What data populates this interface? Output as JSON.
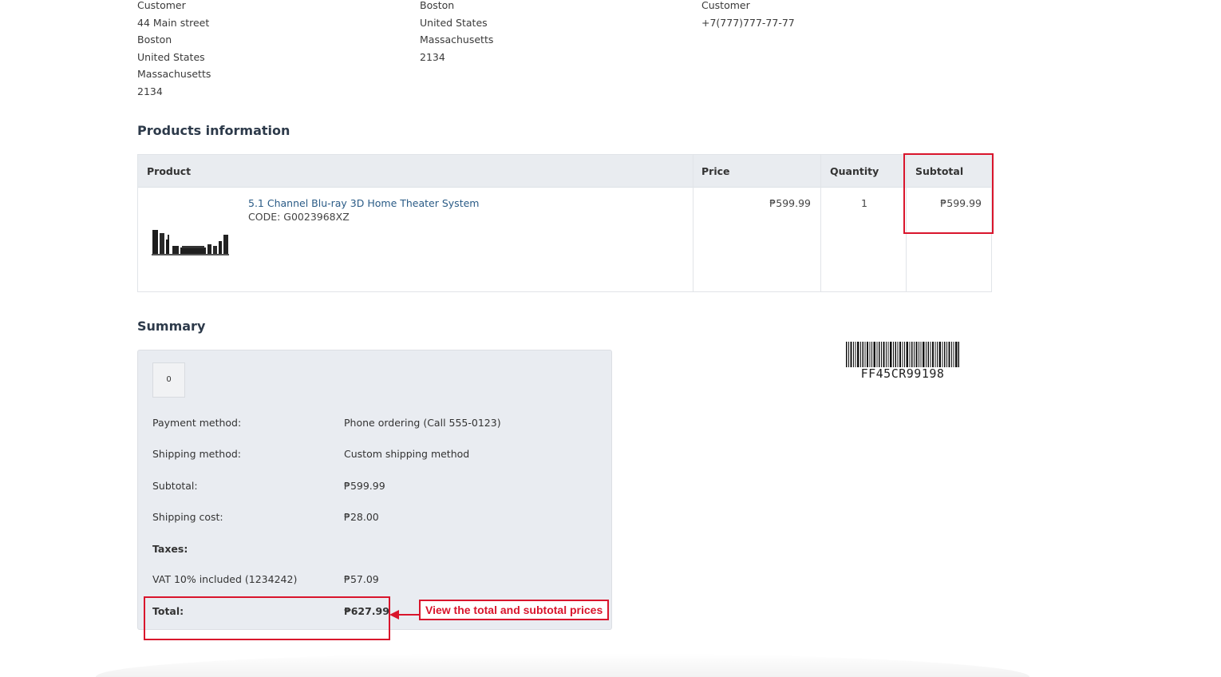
{
  "billing_address": {
    "lines": [
      "Customer",
      "44 Main street",
      "Boston",
      "United States",
      "Massachusetts",
      "2134"
    ]
  },
  "shipping_address": {
    "lines": [
      "Boston",
      "United States",
      "Massachusetts",
      "2134"
    ]
  },
  "contact": {
    "lines": [
      "Customer",
      "+7(777)777-77-77"
    ]
  },
  "products": {
    "title": "Products information",
    "headers": {
      "product": "Product",
      "price": "Price",
      "quantity": "Quantity",
      "subtotal": "Subtotal"
    },
    "rows": [
      {
        "name": "5.1 Channel Blu-ray 3D Home Theater System",
        "code": "CODE: G0023968XZ",
        "price": "₱599.99",
        "quantity": "1",
        "subtotal": "₱599.99",
        "image_icon": "home-theater-image"
      }
    ]
  },
  "summary": {
    "title": "Summary",
    "code_box": "0",
    "payment_method_label": "Payment method:",
    "payment_method_value": "Phone ordering (Call 555-0123)",
    "shipping_method_label": "Shipping method:",
    "shipping_method_value": "Custom shipping method",
    "subtotal_label": "Subtotal:",
    "subtotal_value": "₱599.99",
    "shipping_cost_label": "Shipping cost:",
    "shipping_cost_value": "₱28.00",
    "taxes_label": "Taxes:",
    "vat_label": "VAT 10% included (1234242)",
    "vat_value": "₱57.09",
    "total_label": "Total:",
    "total_value": "₱627.99"
  },
  "barcode": {
    "text": "FF45CR99198"
  },
  "annotation": {
    "text": "View the total and subtotal prices",
    "color": "#d9152c"
  }
}
